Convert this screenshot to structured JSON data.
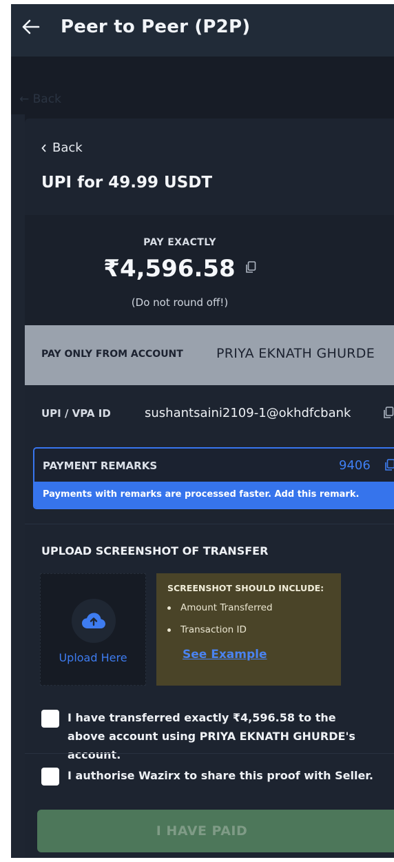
{
  "header": {
    "title": "Peer to Peer (P2P)"
  },
  "background": {
    "back_label": "← Back"
  },
  "card": {
    "back_label": "Back",
    "title": "UPI for 49.99 USDT"
  },
  "payment": {
    "label": "PAY EXACTLY",
    "amount": "₹4,596.58",
    "note": "(Do not round off!)"
  },
  "account": {
    "label": "PAY ONLY FROM ACCOUNT",
    "name": "PRIYA EKNATH GHURDE"
  },
  "upi": {
    "label": "UPI / VPA ID",
    "value": "sushantsaini2109-1@okhdfcbank"
  },
  "remarks": {
    "label": "PAYMENT REMARKS",
    "value": "9406",
    "message": "Payments with remarks are processed faster. Add this remark."
  },
  "upload": {
    "title": "UPLOAD SCREENSHOT OF TRANSFER",
    "button_label": "Upload Here",
    "info_title": "SCREENSHOT SHOULD INCLUDE:",
    "info_items": [
      "Amount Transferred",
      "Transaction ID"
    ],
    "example_link": "See Example"
  },
  "confirmations": {
    "transfer_text": "I have transferred exactly ₹4,596.58 to the above account using PRIYA EKNATH GHURDE's account.",
    "authorise_text": "I authorise Wazirx to share this proof with Seller."
  },
  "submit": {
    "label": "I HAVE PAID"
  },
  "colors": {
    "accent_blue": "#3674ec",
    "info_bg": "#4a4428",
    "button_disabled": "#4d775a"
  }
}
